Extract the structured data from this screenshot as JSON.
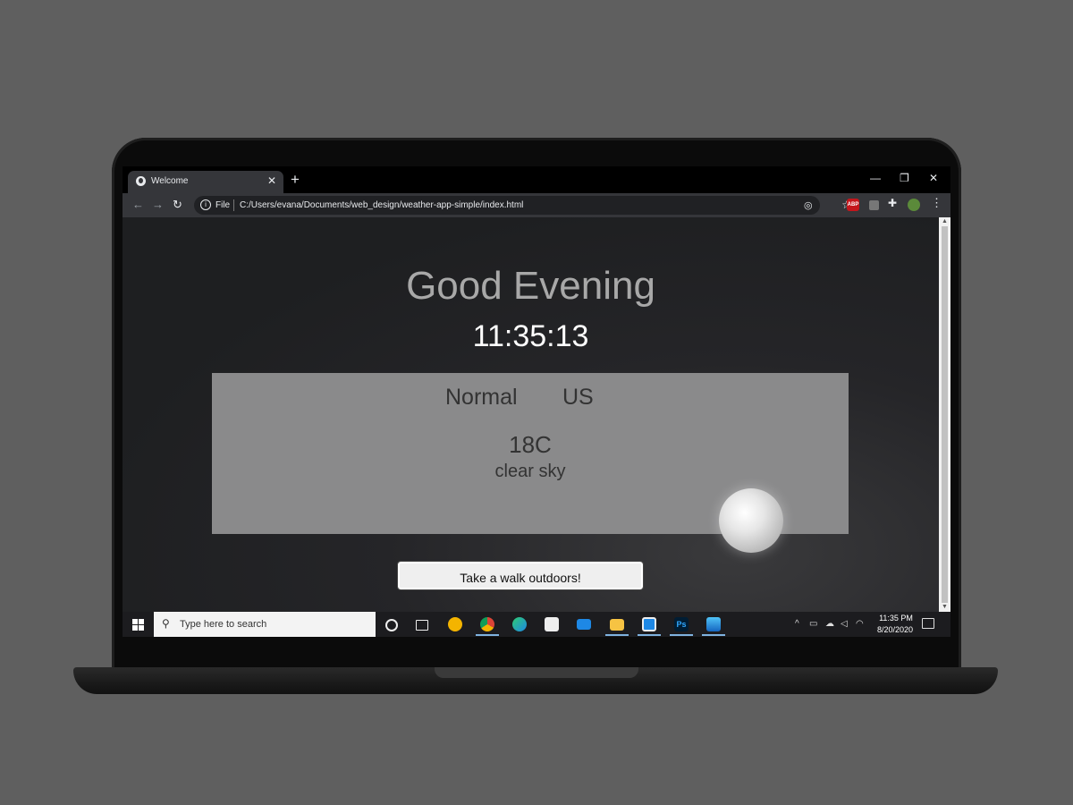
{
  "browser": {
    "tab_title": "Welcome",
    "new_tab": "+",
    "tab_close": "✕",
    "omnibox_scheme": "File",
    "url": "C:/Users/evana/Documents/web_design/weather-app-simple/index.html",
    "window_controls": {
      "minimize": "—",
      "restore": "❐",
      "close": "✕"
    },
    "extensions": {
      "abp_label": "ABP"
    }
  },
  "page": {
    "greeting": "Good Evening",
    "clock": "11:35:13",
    "weather": {
      "city": "Normal",
      "country": "US",
      "temperature": "18C",
      "description": "clear sky"
    },
    "action_button": "Take a walk outdoors!"
  },
  "taskbar": {
    "search_placeholder": "Type here to search",
    "time": "11:35 PM",
    "date": "8/20/2020",
    "pinned_apps": [
      "cortana",
      "task-view",
      "app-circle",
      "chrome",
      "edge",
      "store",
      "mail",
      "file-explorer",
      "app-blue",
      "photoshop",
      "photos"
    ]
  },
  "colors": {
    "greeting": "#a8a8a8",
    "clock": "#ffffff",
    "card": "#8a8a8b",
    "desktop": "#5f5f5f"
  }
}
